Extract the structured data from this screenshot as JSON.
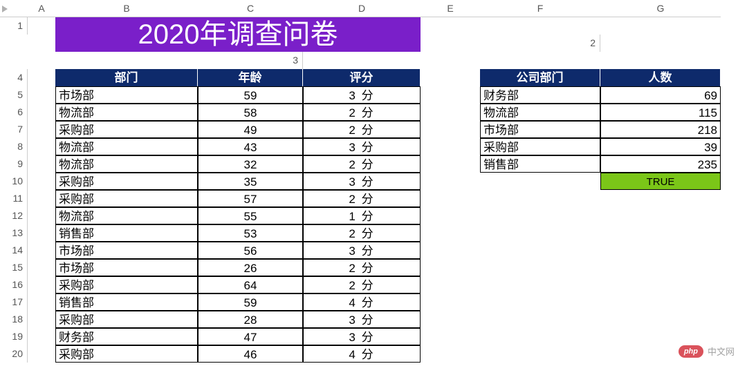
{
  "columns": [
    "",
    "A",
    "B",
    "C",
    "D",
    "E",
    "F",
    "G"
  ],
  "rows": [
    "1",
    "2",
    "3",
    "4",
    "5",
    "6",
    "7",
    "8",
    "9",
    "10",
    "11",
    "12",
    "13",
    "14",
    "15",
    "16",
    "17",
    "18",
    "19",
    "20"
  ],
  "title": "2020年调查问卷",
  "survey_headers": {
    "dept": "部门",
    "age": "年龄",
    "score": "评分"
  },
  "survey": [
    {
      "dept": "市场部",
      "age": "59",
      "score": "3 分"
    },
    {
      "dept": "物流部",
      "age": "58",
      "score": "2 分"
    },
    {
      "dept": "采购部",
      "age": "49",
      "score": "2 分"
    },
    {
      "dept": "物流部",
      "age": "43",
      "score": "3 分"
    },
    {
      "dept": "物流部",
      "age": "32",
      "score": "2 分"
    },
    {
      "dept": "采购部",
      "age": "35",
      "score": "3 分"
    },
    {
      "dept": "采购部",
      "age": "57",
      "score": "2 分"
    },
    {
      "dept": "物流部",
      "age": "55",
      "score": "1 分"
    },
    {
      "dept": "销售部",
      "age": "53",
      "score": "2 分"
    },
    {
      "dept": "市场部",
      "age": "56",
      "score": "3 分"
    },
    {
      "dept": "市场部",
      "age": "26",
      "score": "2 分"
    },
    {
      "dept": "采购部",
      "age": "64",
      "score": "2 分"
    },
    {
      "dept": "销售部",
      "age": "59",
      "score": "4 分"
    },
    {
      "dept": "采购部",
      "age": "28",
      "score": "3 分"
    },
    {
      "dept": "财务部",
      "age": "47",
      "score": "3 分"
    },
    {
      "dept": "采购部",
      "age": "46",
      "score": "4 分"
    }
  ],
  "summary_headers": {
    "dept": "公司部门",
    "count": "人数"
  },
  "summary": [
    {
      "dept": "财务部",
      "count": "69"
    },
    {
      "dept": "物流部",
      "count": "115"
    },
    {
      "dept": "市场部",
      "count": "218"
    },
    {
      "dept": "采购部",
      "count": "39"
    },
    {
      "dept": "销售部",
      "count": "235"
    }
  ],
  "true_label": "TRUE",
  "watermark": {
    "badge": "php",
    "text": "中文网"
  }
}
